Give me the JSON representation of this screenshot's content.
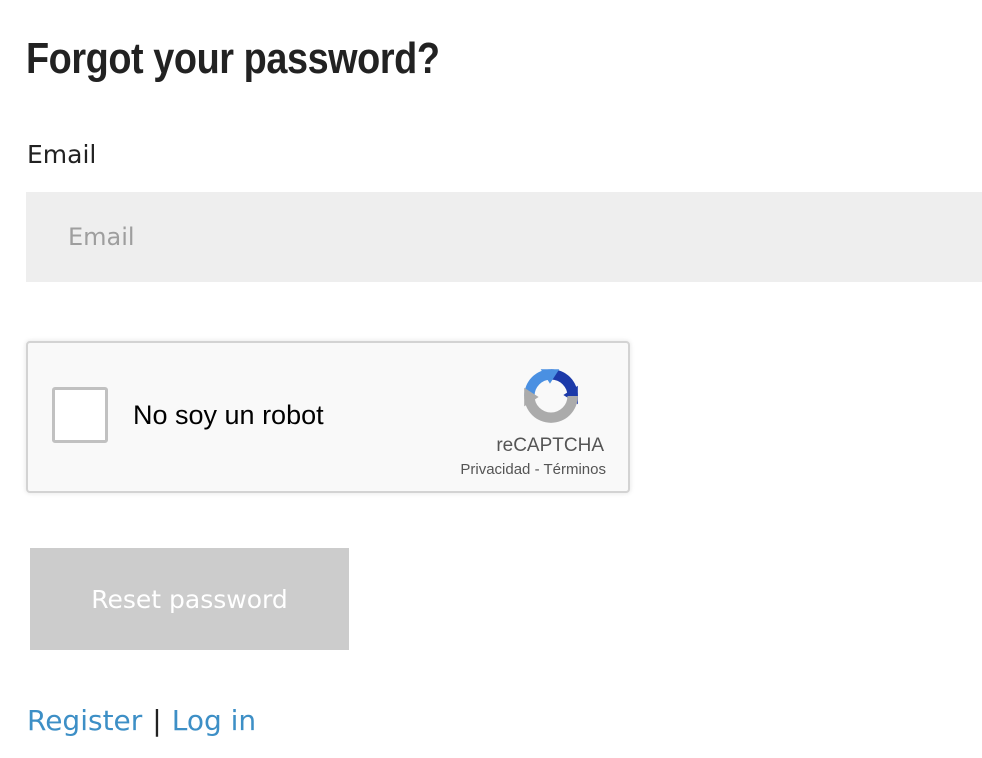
{
  "page": {
    "title": "Forgot your password?"
  },
  "form": {
    "email_label": "Email",
    "email_placeholder": "Email",
    "email_value": "",
    "submit_label": "Reset password"
  },
  "recaptcha": {
    "checkbox_label": "No soy un robot",
    "checked": false,
    "brand": "reCAPTCHA",
    "privacy_link": "Privacidad",
    "separator": "-",
    "terms_link": "Términos",
    "logo_icon": "recaptcha-logo-icon"
  },
  "links": {
    "register": "Register",
    "separator": "|",
    "login": "Log in"
  },
  "colors": {
    "link": "#3d8fc6",
    "button_disabled": "#cccccc",
    "input_bg": "#eeeeee",
    "recaptcha_blue_dark": "#1c3aa9",
    "recaptcha_blue_light": "#4a90e2",
    "recaptcha_grey": "#ababab"
  }
}
